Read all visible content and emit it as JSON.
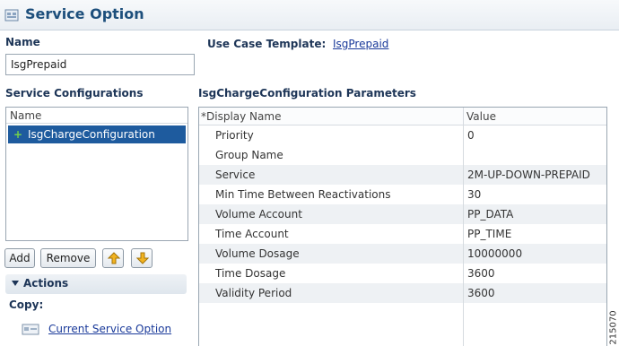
{
  "header": {
    "title": "Service Option"
  },
  "name_section": {
    "label": "Name",
    "value": "IsgPrepaid"
  },
  "use_case": {
    "label": "Use Case Template:",
    "link": "IsgPrepaid"
  },
  "service_configurations": {
    "label": "Service Configurations",
    "column": "Name",
    "items": [
      {
        "label": "IsgChargeConfiguration",
        "selected": true
      }
    ]
  },
  "buttons": {
    "add": "Add",
    "remove": "Remove",
    "up_icon": "arrow-up-icon",
    "down_icon": "arrow-down-icon"
  },
  "actions": {
    "title": "Actions",
    "copy_label": "Copy:",
    "copy_link": "Current Service Option"
  },
  "parameters": {
    "title": "IsgChargeConfiguration Parameters",
    "columns": [
      "*Display Name",
      "Value"
    ],
    "rows": [
      {
        "name": "Priority",
        "value": "0"
      },
      {
        "name": "Group Name",
        "value": ""
      },
      {
        "name": "Service",
        "value": "2M-UP-DOWN-PREPAID"
      },
      {
        "name": "Min Time Between Reactivations",
        "value": "30"
      },
      {
        "name": "Volume Account",
        "value": "PP_DATA"
      },
      {
        "name": "Time Account",
        "value": "PP_TIME"
      },
      {
        "name": "Volume Dosage",
        "value": "10000000"
      },
      {
        "name": "Time Dosage",
        "value": "3600"
      },
      {
        "name": "Validity Period",
        "value": "3600"
      }
    ]
  },
  "figure_id": "215070",
  "colors": {
    "selection": "#1e5b9e",
    "link": "#1a3a9a",
    "heading": "#1d3557",
    "title": "#1d4f7c",
    "arrow": "#f2b320",
    "plus": "#74d24a"
  }
}
